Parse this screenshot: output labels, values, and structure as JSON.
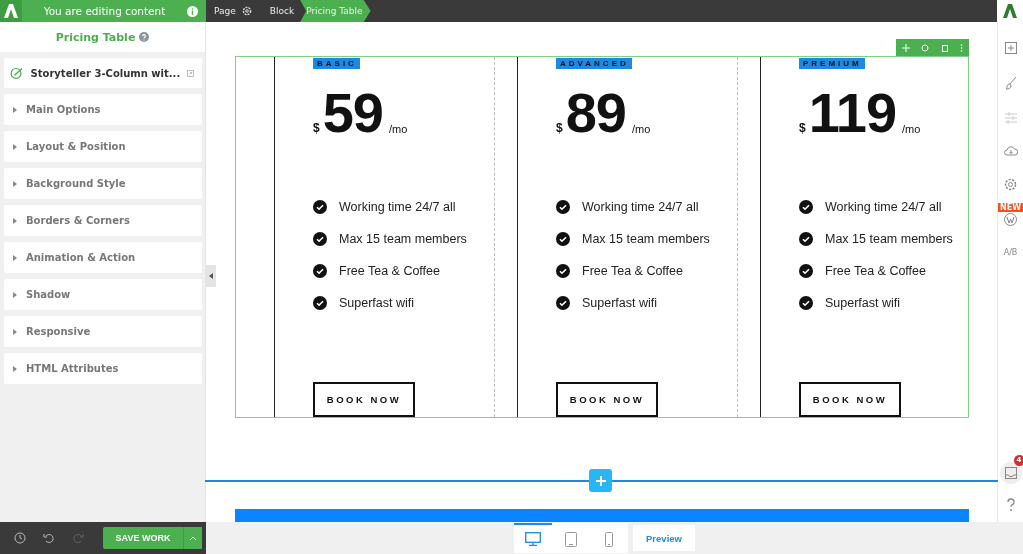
{
  "topbar": {
    "mode": "You are editing content",
    "breadcrumbs": [
      {
        "label": "Page",
        "selected": false
      },
      {
        "label": "Block",
        "selected": false
      },
      {
        "label": "Pricing Table",
        "selected": true
      }
    ]
  },
  "sidebar": {
    "title": "Pricing Table",
    "template": "Storyteller 3-Column wit...",
    "sections": [
      {
        "label": "Main Options"
      },
      {
        "label": "Layout & Position"
      },
      {
        "label": "Background Style"
      },
      {
        "label": "Borders & Corners"
      },
      {
        "label": "Animation & Action"
      },
      {
        "label": "Shadow"
      },
      {
        "label": "Responsive"
      },
      {
        "label": "HTML Attributes"
      }
    ]
  },
  "plans": [
    {
      "name": "BASIC",
      "currency": "$",
      "price": "59",
      "period": "/mo",
      "features": [
        "Working time 24/7 all",
        "Max 15 team members",
        "Free Tea & Coffee",
        "Superfast wifi"
      ],
      "button": "BOOK NOW"
    },
    {
      "name": "ADVANCED",
      "currency": "$",
      "price": "89",
      "period": "/mo",
      "features": [
        "Working time 24/7 all",
        "Max 15 team members",
        "Free Tea & Coffee",
        "Superfast wifi"
      ],
      "button": "BOOK NOW"
    },
    {
      "name": "PREMIUM",
      "currency": "$",
      "price": "119",
      "period": "/mo",
      "features": [
        "Working time 24/7 all",
        "Max 15 team members",
        "Free Tea & Coffee",
        "Superfast wifi"
      ],
      "button": "BOOK NOW"
    }
  ],
  "rail": {
    "new_badge": "NEW",
    "lang_icon": "A/B",
    "notification_count": "4"
  },
  "bottom": {
    "save": "SAVE WORK",
    "devices": [
      {
        "kind": "desktop",
        "selected": true
      },
      {
        "kind": "tablet",
        "selected": false
      },
      {
        "kind": "phone",
        "selected": false
      }
    ],
    "preview": "Preview"
  }
}
